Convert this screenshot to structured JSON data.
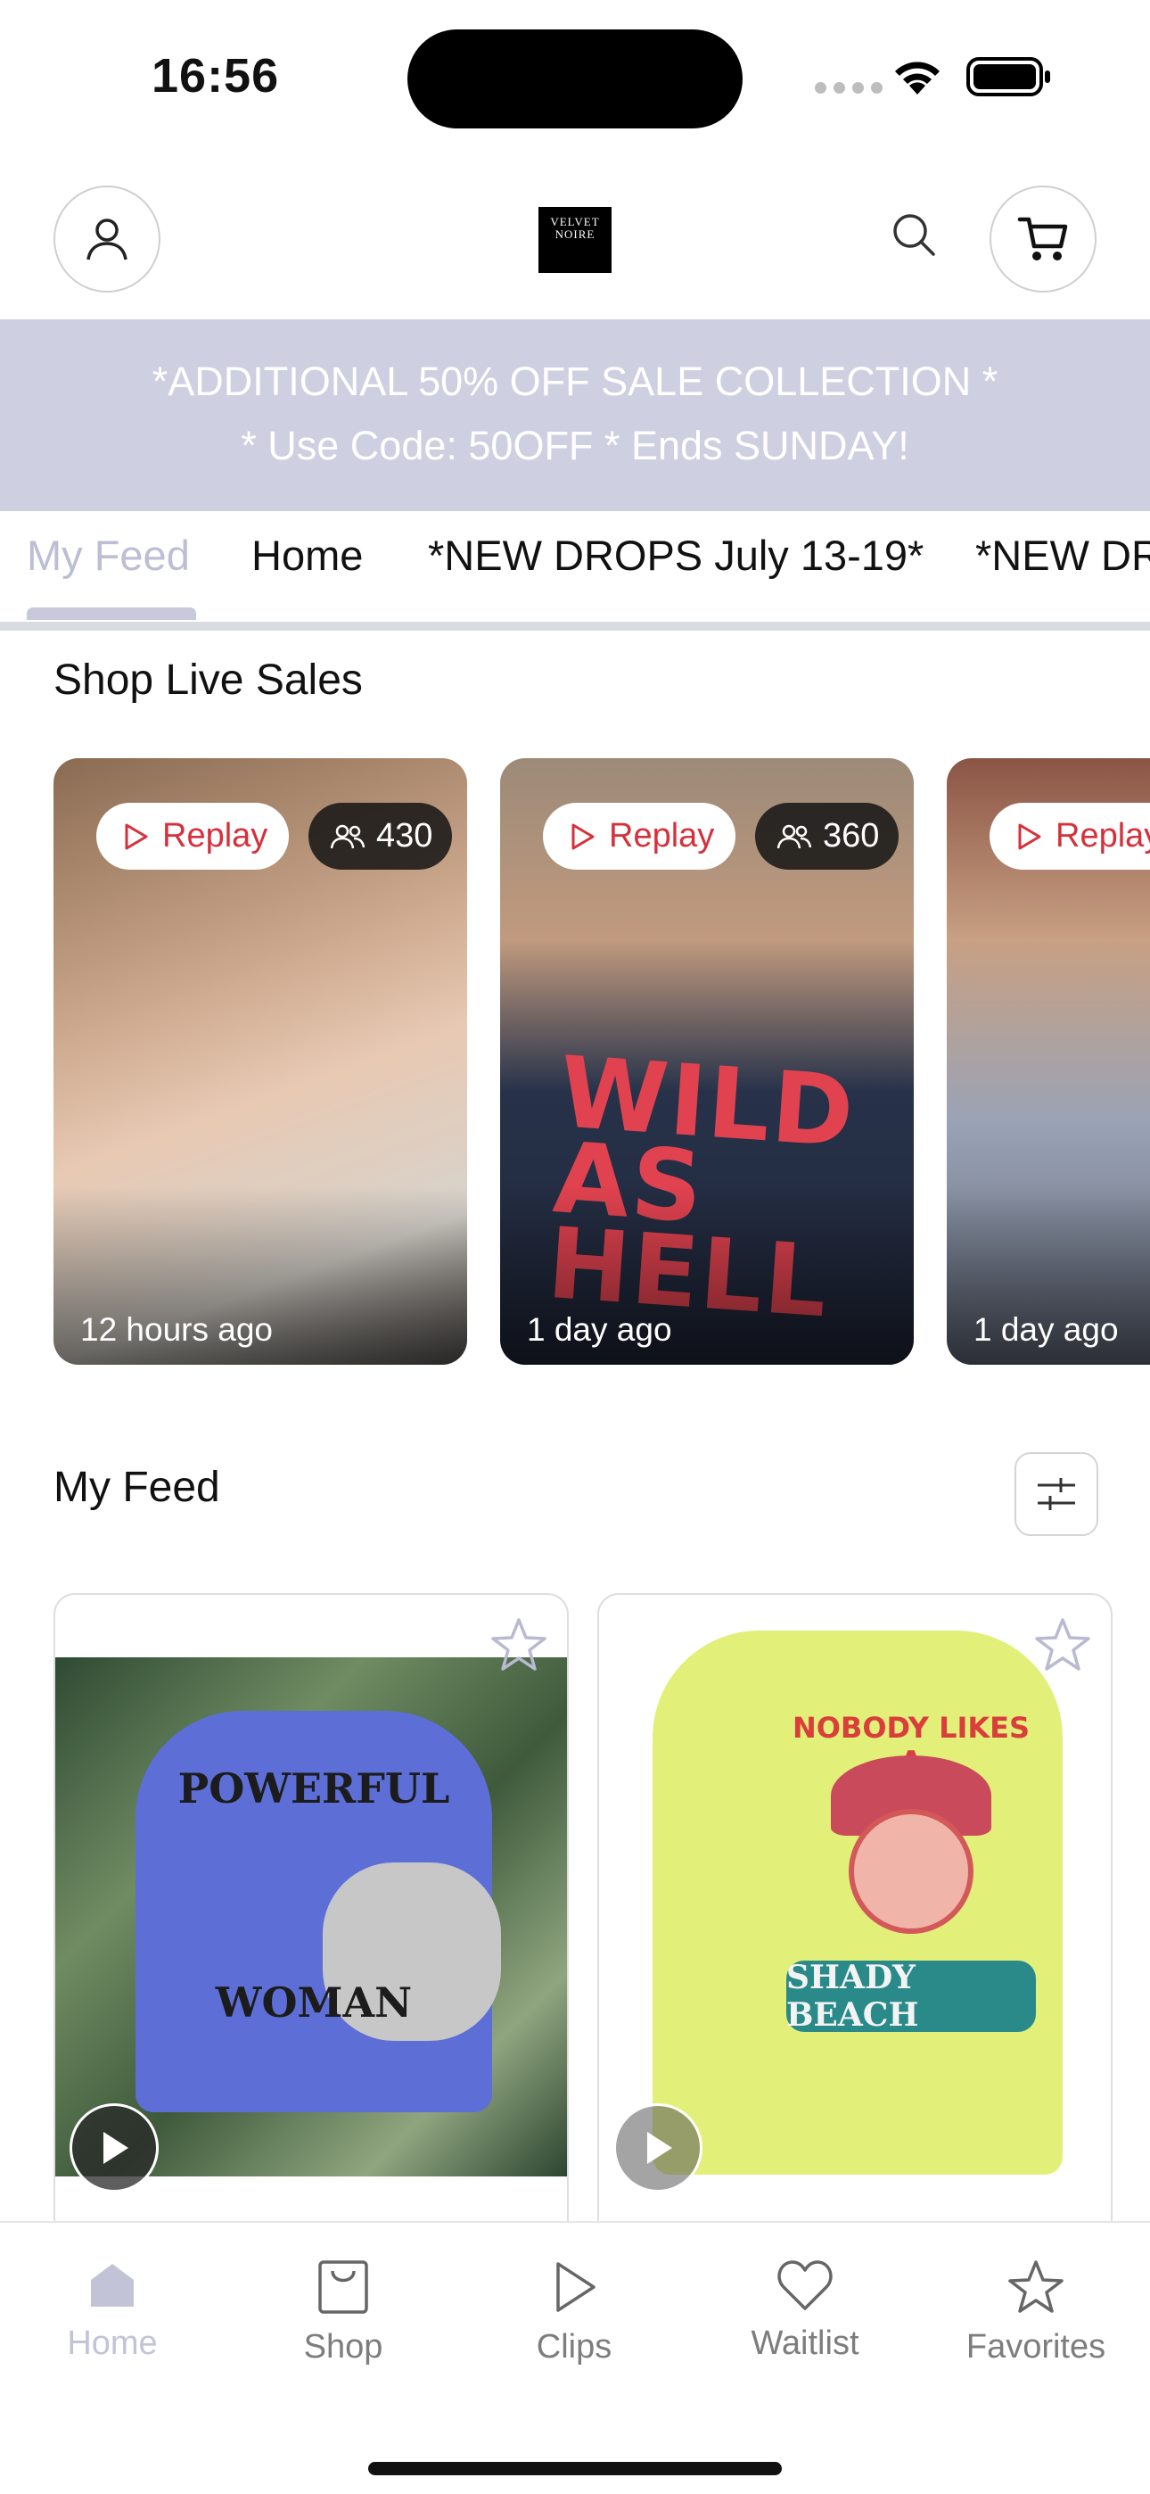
{
  "status_bar": {
    "time": "16:56"
  },
  "header": {
    "logo_text": "VELVET NOIRE"
  },
  "promo": {
    "line1": "*ADDITIONAL 50% OFF SALE COLLECTION *",
    "line2": "* Use Code: 50OFF * Ends SUNDAY!"
  },
  "tabs": [
    {
      "label": "My Feed",
      "active": true
    },
    {
      "label": "Home"
    },
    {
      "label": "*NEW DROPS July 13-19*"
    },
    {
      "label": "*NEW DROPS"
    }
  ],
  "live_sales": {
    "title": "Shop Live Sales",
    "cards": [
      {
        "replay_label": "Replay",
        "viewers": "430",
        "time": "12 hours ago"
      },
      {
        "replay_label": "Replay",
        "viewers": "360",
        "time": "1 day ago",
        "art_text": "WILD AS HELL"
      },
      {
        "replay_label": "Replay",
        "time": "1 day ago"
      }
    ]
  },
  "feed": {
    "title": "My Feed",
    "products": [
      {
        "art_top": "POWERFUL",
        "art_bottom": "WOMAN",
        "color": "#5d6fd6"
      },
      {
        "art_top": "NOBODY LIKES A",
        "art_bottom": "SHADY BEACH",
        "color": "#e2f07a"
      }
    ]
  },
  "bottom_nav": [
    {
      "label": "Home",
      "icon": "home-icon",
      "active": true
    },
    {
      "label": "Shop",
      "icon": "bag-icon"
    },
    {
      "label": "Clips",
      "icon": "play-icon"
    },
    {
      "label": "Waitlist",
      "icon": "heart-icon"
    },
    {
      "label": "Favorites",
      "icon": "star-icon"
    }
  ],
  "colors": {
    "promo_bg": "#cfcfe2",
    "replay_red": "#d6303b",
    "active_tab": "#bdbdd6"
  }
}
